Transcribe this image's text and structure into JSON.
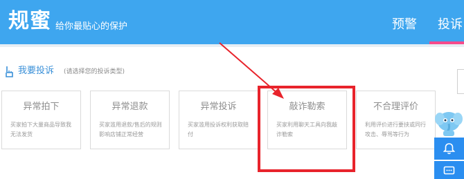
{
  "header": {
    "brand_title": "规蜜",
    "brand_slogan": "给你最贴心的保护",
    "tabs": [
      {
        "label": "预警"
      },
      {
        "label": "投诉",
        "active": true
      }
    ],
    "bg_color": "#3ea6ef",
    "active_tab_color": "#f64b8c"
  },
  "section": {
    "title": "我要投诉",
    "hint": "(请选择您的投诉类型)"
  },
  "cards": [
    {
      "title": "异常拍下",
      "desc": "买家拍下大量商品导致我无法发货"
    },
    {
      "title": "异常退款",
      "desc": "买家滥用退款/售后的规则影响店铺正常经营"
    },
    {
      "title": "异常投诉",
      "desc": "买家滥用投诉权利获取赔付"
    },
    {
      "title": "敲诈勒索",
      "desc": "买家利用聊天工具向我敲诈勒索",
      "highlighted": true
    },
    {
      "title": "不合理评价",
      "desc": "利用评价进行要挟或同行攻击、辱骂等行为"
    }
  ],
  "annotation": {
    "color": "#e8232b"
  },
  "sidebar": {
    "icons": [
      "mascot-icon",
      "bell-icon",
      "chat-icon"
    ],
    "color": "#2b8ef0"
  }
}
